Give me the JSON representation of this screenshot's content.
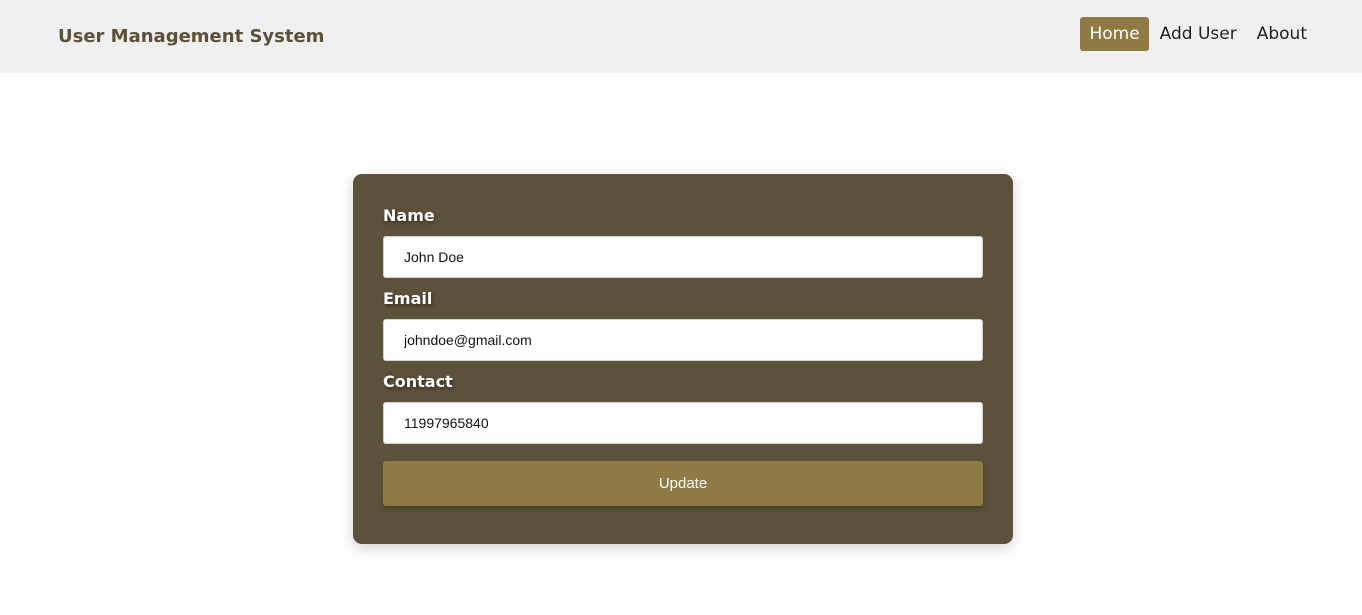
{
  "header": {
    "brand": "User Management System",
    "nav": [
      {
        "label": "Home",
        "active": true
      },
      {
        "label": "Add User",
        "active": false
      },
      {
        "label": "About",
        "active": false
      }
    ]
  },
  "form": {
    "fields": [
      {
        "label": "Name",
        "value": "John Doe"
      },
      {
        "label": "Email",
        "value": "johndoe@gmail.com"
      },
      {
        "label": "Contact",
        "value": "11997965840"
      }
    ],
    "submit_label": "Update"
  },
  "colors": {
    "accent": "#8e7a44",
    "card_background": "#5c513b",
    "header_background": "#f0f0f0",
    "brand_text": "#5c503a"
  }
}
